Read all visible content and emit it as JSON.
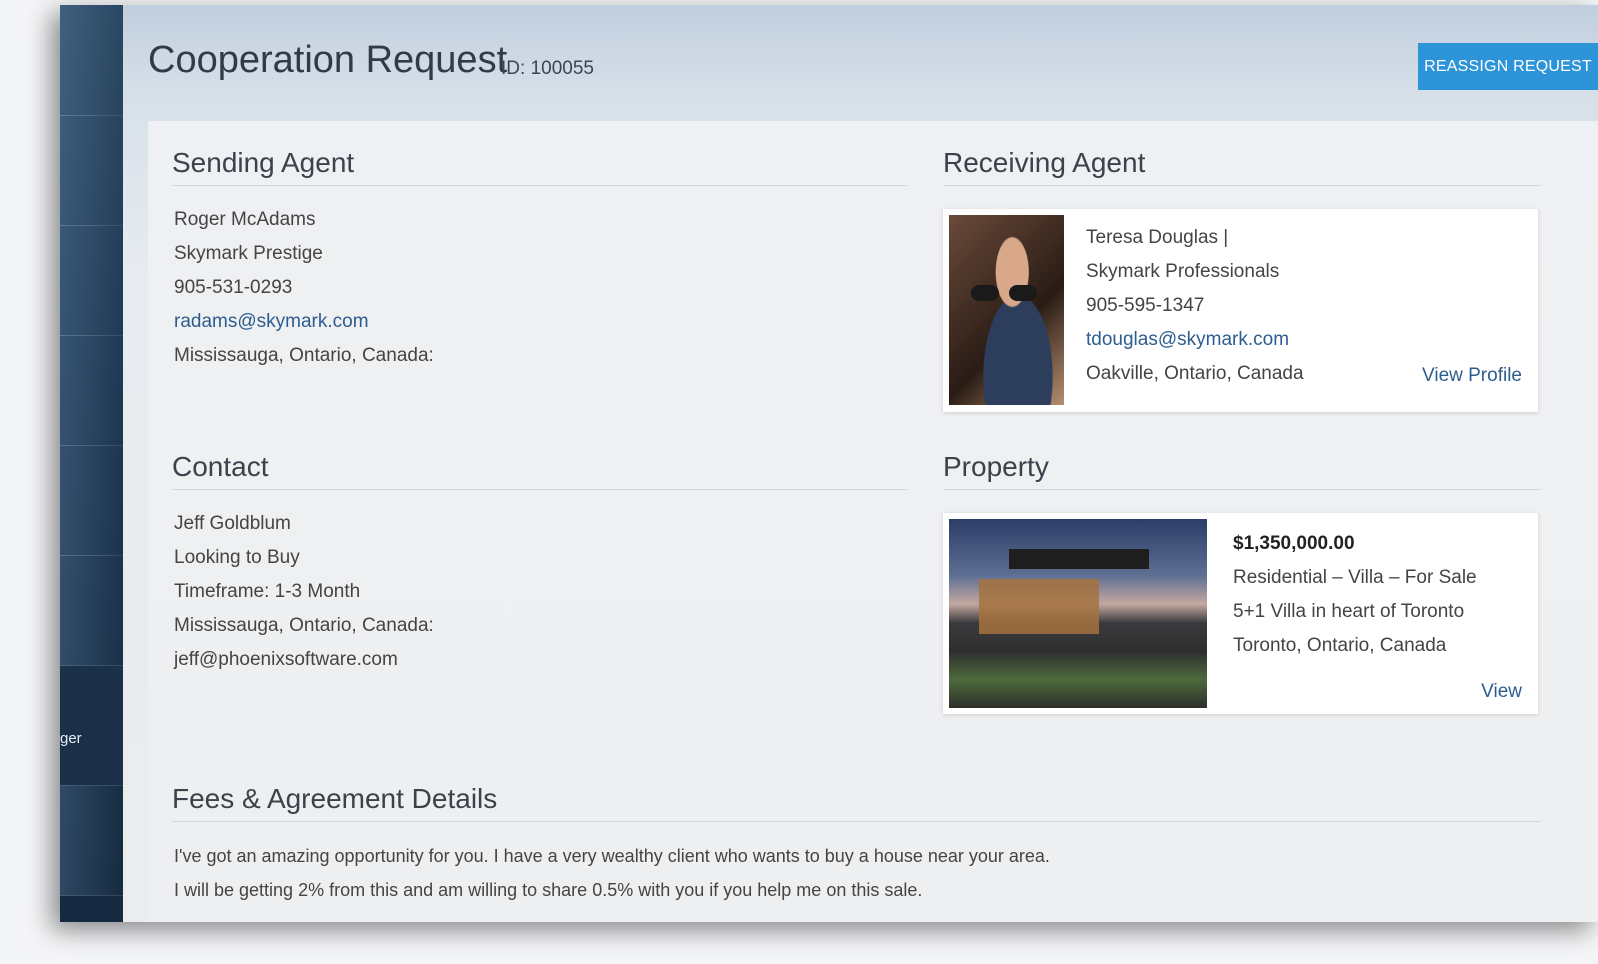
{
  "sidebar": {
    "partial_label": "ger"
  },
  "header": {
    "title": "Cooperation Request",
    "request_id": "ID: 100055",
    "reassign_label": "REASSIGN REQUEST"
  },
  "sending_agent": {
    "heading": "Sending Agent",
    "name": "Roger McAdams",
    "company": "Skymark Prestige",
    "phone": "905-531-0293",
    "email": "radams@skymark.com",
    "location": "Mississauga, Ontario, Canada:"
  },
  "receiving_agent": {
    "heading": "Receiving Agent",
    "name": "Teresa Douglas |",
    "company": "Skymark Professionals",
    "phone": "905-595-1347",
    "email": "tdouglas@skymark.com",
    "location": "Oakville, Ontario, Canada",
    "view_profile": "View Profile"
  },
  "contact": {
    "heading": "Contact",
    "name": "Jeff Goldblum",
    "intent": "Looking to Buy",
    "timeframe": "Timeframe: 1-3 Month",
    "location": "Mississauga, Ontario, Canada:",
    "email": "jeff@phoenixsoftware.com"
  },
  "property": {
    "heading": "Property",
    "price": "$1,350,000.00",
    "type": "Residential – Villa – For Sale",
    "description": "5+1 Villa in heart of Toronto",
    "location": "Toronto, Ontario, Canada",
    "view": "View"
  },
  "fees": {
    "heading": "Fees & Agreement Details",
    "line1": "I've got an amazing opportunity for you. I have a very wealthy client who wants to buy a house near your area.",
    "line2": "I will be getting 2% from this and am willing to share 0.5% with you if you help me on this sale."
  }
}
